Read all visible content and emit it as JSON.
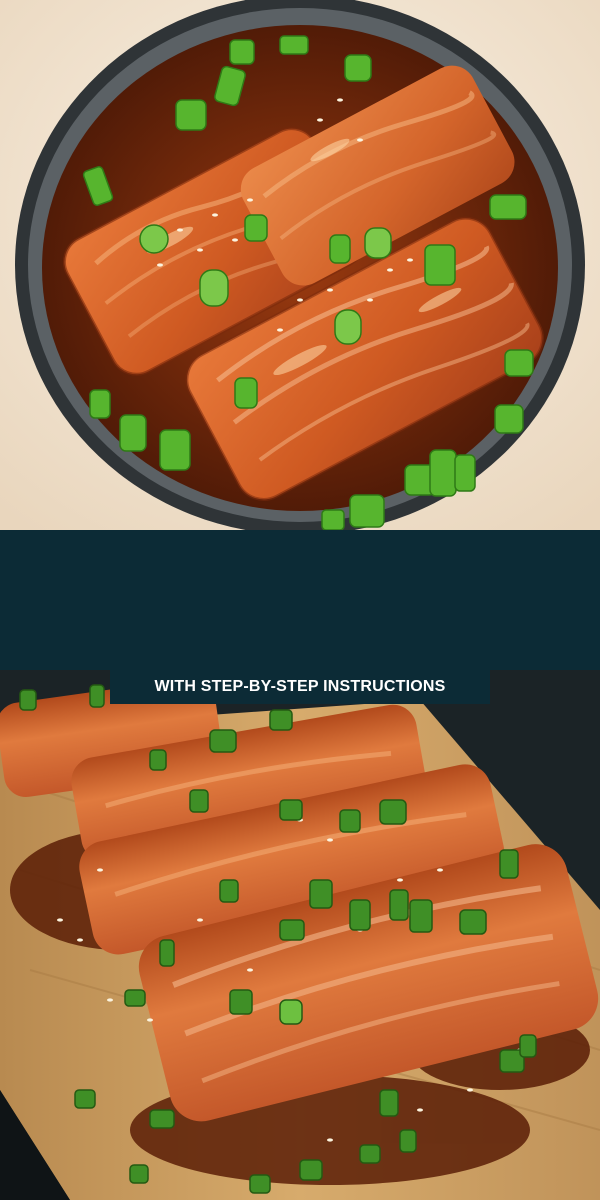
{
  "colors": {
    "band": "#0c2b36",
    "banner_bg": "#0c2b36",
    "banner_text": "#ffffff",
    "background": "#f2e6d6",
    "salmon": "#d9662b",
    "glaze": "#7a2a0c",
    "scallion": "#4fae2a",
    "board": "#c99a5c"
  },
  "banner": {
    "text": "WITH STEP-BY-STEP INSTRUCTIONS"
  }
}
